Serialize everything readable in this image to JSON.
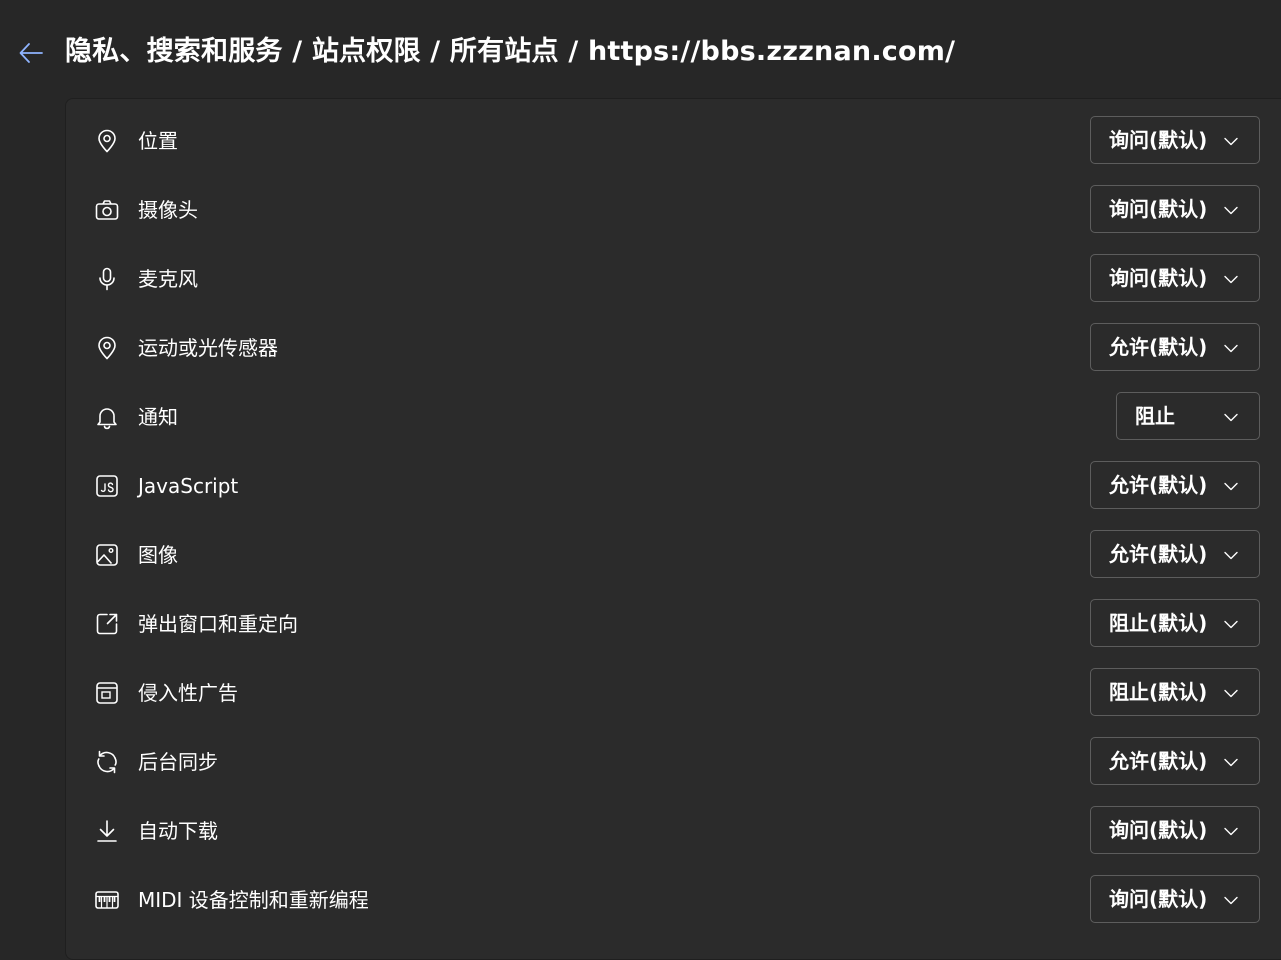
{
  "header": {
    "title": "隐私、搜索和服务 / 站点权限 / 所有站点 / https://bbs.zzznan.com/",
    "back_icon": "back-arrow-icon",
    "accent": "#8fb4ff"
  },
  "permissions": [
    {
      "id": "location",
      "icon": "location-pin-icon",
      "label": "位置",
      "value": "询问(默认)"
    },
    {
      "id": "camera",
      "icon": "camera-icon",
      "label": "摄像头",
      "value": "询问(默认)"
    },
    {
      "id": "microphone",
      "icon": "microphone-icon",
      "label": "麦克风",
      "value": "询问(默认)"
    },
    {
      "id": "motion-sensors",
      "icon": "location-pin-icon",
      "label": "运动或光传感器",
      "value": "允许(默认)"
    },
    {
      "id": "notifications",
      "icon": "bell-icon",
      "label": "通知",
      "value": "阻止"
    },
    {
      "id": "javascript",
      "icon": "javascript-icon",
      "label": "JavaScript",
      "value": "允许(默认)"
    },
    {
      "id": "images",
      "icon": "image-icon",
      "label": "图像",
      "value": "允许(默认)"
    },
    {
      "id": "popups",
      "icon": "popout-icon",
      "label": "弹出窗口和重定向",
      "value": "阻止(默认)"
    },
    {
      "id": "intrusive-ads",
      "icon": "ad-window-icon",
      "label": "侵入性广告",
      "value": "阻止(默认)"
    },
    {
      "id": "background-sync",
      "icon": "sync-icon",
      "label": "后台同步",
      "value": "允许(默认)"
    },
    {
      "id": "auto-downloads",
      "icon": "download-icon",
      "label": "自动下载",
      "value": "询问(默认)"
    },
    {
      "id": "midi",
      "icon": "piano-keyboard-icon",
      "label": "MIDI 设备控制和重新编程",
      "value": "询问(默认)"
    }
  ]
}
